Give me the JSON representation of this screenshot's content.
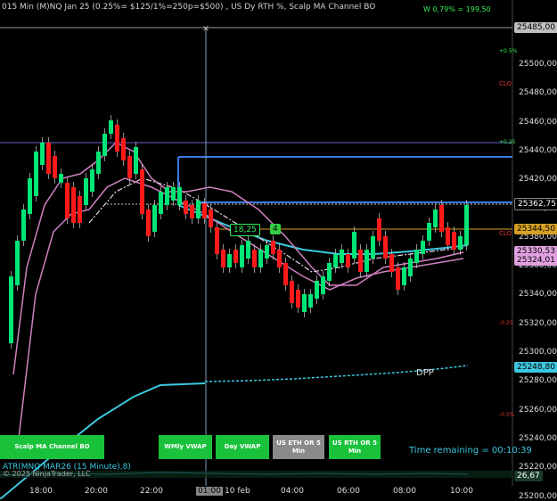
{
  "header": {
    "title": "015 Min (M)NQ Jan 25  (0.25%= $125/1%=250p=$500) , US Dy RTH %, Scalp MA Channel BO",
    "pnl": "W 0,79% = 199,50"
  },
  "price_axis": {
    "ticks": [
      "25500,00",
      "25480,00",
      "25460,00",
      "25440,00",
      "25420,00",
      "25400,00",
      "25380,00",
      "25360,00",
      "25340,00",
      "25320,00",
      "25300,00",
      "25280,00",
      "25260,00",
      "25240,00",
      "25220,00",
      "25200,00"
    ],
    "labels": {
      "top_tag": "25485,00",
      "plus05": "+0.5%",
      "clo1": "CLO",
      "plus025": "+0.25",
      "last": "25362,75",
      "orange": "25344,50",
      "clo2": "CLO",
      "pink1": "25330,53",
      "pink2": "25324,01",
      "minus025": "-0.25",
      "cyan": "25248,80",
      "minus05": "-0.5%",
      "bottom": "26,67"
    }
  },
  "time_axis": {
    "ticks": [
      "18:00",
      "20:00",
      "22:00",
      "01:00",
      "10 feb",
      "04:00",
      "06:00",
      "08:00",
      "10:00"
    ]
  },
  "buttons": [
    {
      "label": "Scalp MA Channel BO",
      "color": "#19c23a"
    },
    {
      "label": "WMly VWAP",
      "color": "#19c23a"
    },
    {
      "label": "Day VWAP",
      "color": "#19c23a"
    },
    {
      "label": "US ETH OR 5 Min",
      "color": "#8a8a8a"
    },
    {
      "label": "US RTH OR 5 Min",
      "color": "#19c23a"
    }
  ],
  "chart_labels": {
    "measure": "18,25",
    "measure_count": "4",
    "dpp": "DPP",
    "time_remaining": "Time remaining = 00:10:39"
  },
  "indicator_panel": {
    "label": "ATR(MNQ MAR26 (15 Minute),8)",
    "copyright": "© 2025 NinjaTrader, LLC"
  },
  "colors": {
    "up": "#00e676",
    "down": "#ff1a1a",
    "cyan": "#3cc8e0",
    "pink": "#d080c0",
    "orange": "#d6a020",
    "blue_line": "#6666cc",
    "bg": "#000000"
  }
}
